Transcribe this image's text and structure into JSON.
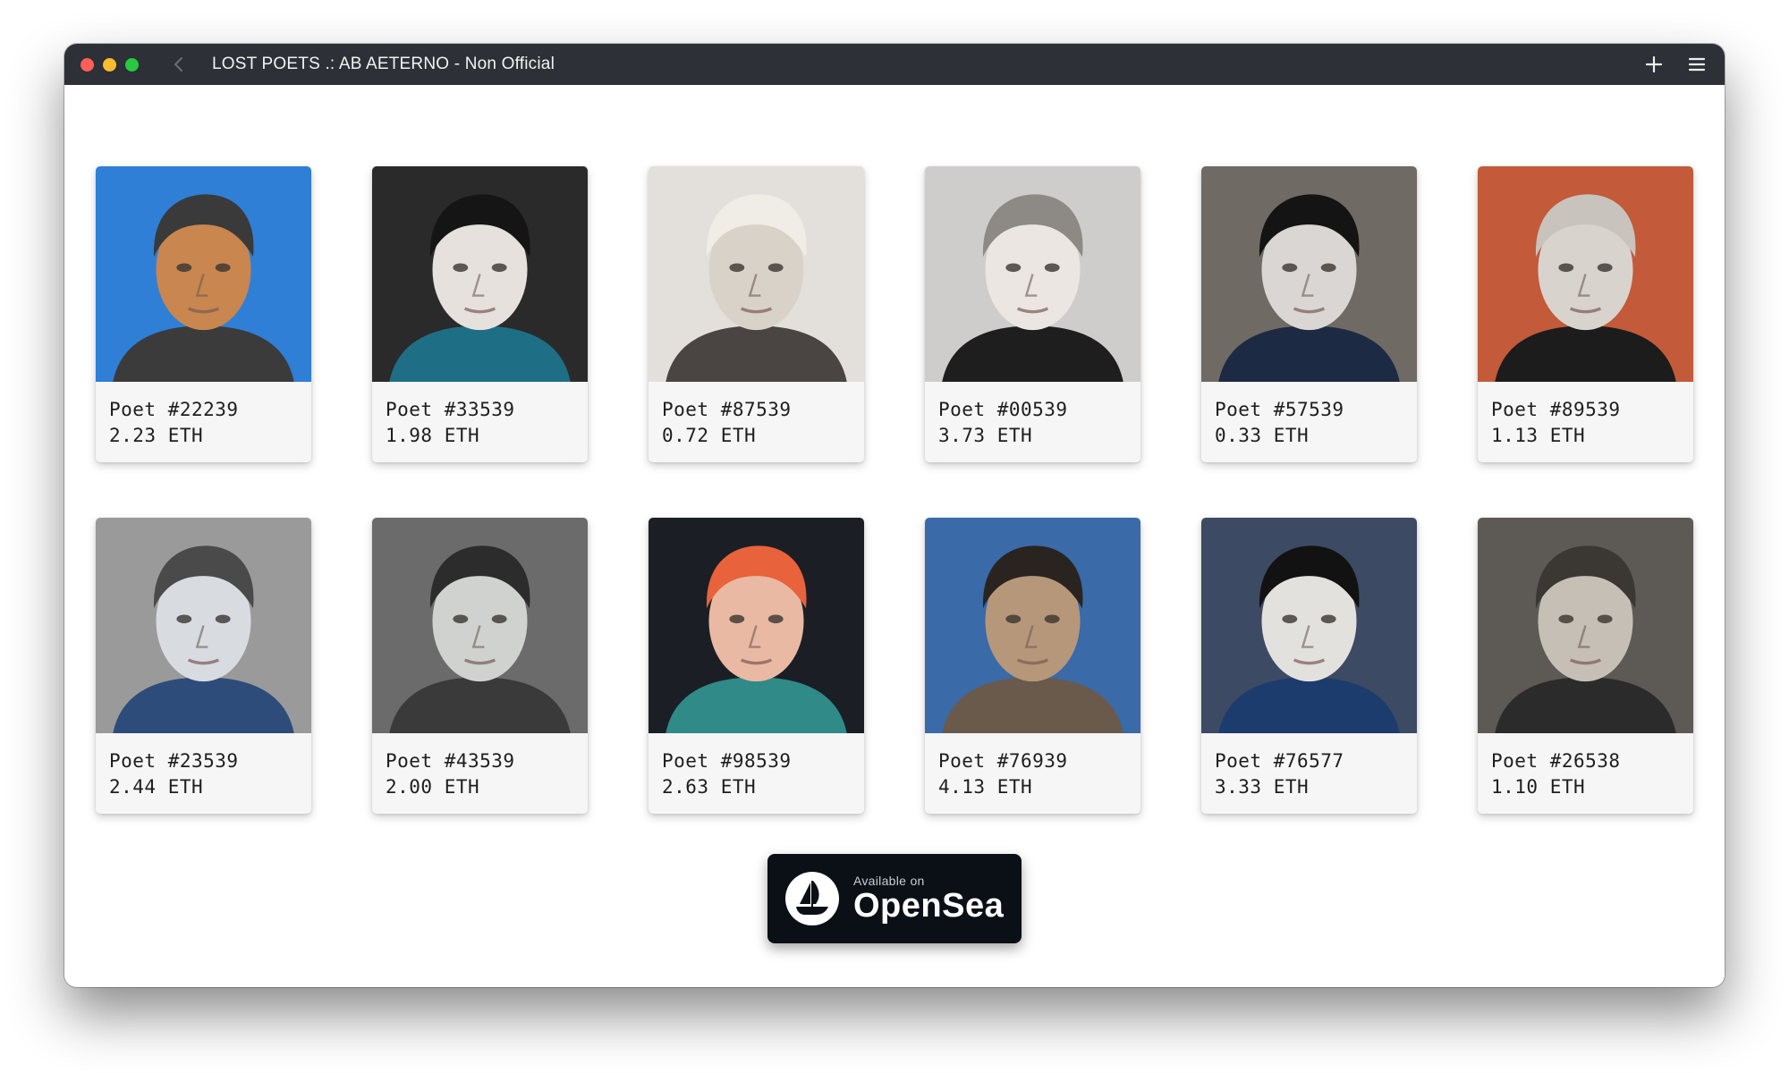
{
  "window": {
    "title": "LOST POETS .: AB AETERNO - Non Official"
  },
  "poets": [
    {
      "name": "Poet #22239",
      "price": "2.23 ETH",
      "bg": "#2f7fd6",
      "skin": "#c9864f",
      "hair": "#3a3a3a",
      "shirt": "#3b3b3b"
    },
    {
      "name": "Poet #33539",
      "price": "1.98 ETH",
      "bg": "#2a2a2a",
      "skin": "#e6e1dc",
      "hair": "#151515",
      "shirt": "#1e6f86"
    },
    {
      "name": "Poet #87539",
      "price": "0.72 ETH",
      "bg": "#e3e0dc",
      "skin": "#d9d2c8",
      "hair": "#f0ece6",
      "shirt": "#4a4542"
    },
    {
      "name": "Poet #00539",
      "price": "3.73 ETH",
      "bg": "#cfcdcb",
      "skin": "#ece6e2",
      "hair": "#8d8a86",
      "shirt": "#1e1e1e"
    },
    {
      "name": "Poet #57539",
      "price": "0.33 ETH",
      "bg": "#6f6a63",
      "skin": "#d9d6d3",
      "hair": "#141414",
      "shirt": "#1d2a44"
    },
    {
      "name": "Poet #89539",
      "price": "1.13 ETH",
      "bg": "#c35a3a",
      "skin": "#d8d3cd",
      "hair": "#c8c3bd",
      "shirt": "#1c1c1c"
    },
    {
      "name": "Poet #23539",
      "price": "2.44 ETH",
      "bg": "#9a9a9a",
      "skin": "#d8dbe0",
      "hair": "#4a4a4a",
      "shirt": "#2d4c7a"
    },
    {
      "name": "Poet #43539",
      "price": "2.00 ETH",
      "bg": "#6b6b6b",
      "skin": "#cfd2cf",
      "hair": "#2c2c2c",
      "shirt": "#3a3a3a"
    },
    {
      "name": "Poet #98539",
      "price": "2.63 ETH",
      "bg": "#1b1f25",
      "skin": "#e9b9a4",
      "hair": "#e8623b",
      "shirt": "#2f8a88"
    },
    {
      "name": "Poet #76939",
      "price": "4.13 ETH",
      "bg": "#3a6aa8",
      "skin": "#b7977a",
      "hair": "#2a2420",
      "shirt": "#6a5a4c"
    },
    {
      "name": "Poet #76577",
      "price": "3.33 ETH",
      "bg": "#3d4a63",
      "skin": "#e3e1de",
      "hair": "#121212",
      "shirt": "#1d3c6e"
    },
    {
      "name": "Poet #26538",
      "price": "1.10 ETH",
      "bg": "#5d5a55",
      "skin": "#c6bfb5",
      "hair": "#3b3834",
      "shirt": "#2b2b2b"
    }
  ],
  "opensea": {
    "small_label": "Available on",
    "big_label": "OpenSea"
  },
  "icons": {
    "back": "chevron-left-icon",
    "add": "plus-icon",
    "menu": "hamburger-menu-icon",
    "opensea": "opensea-ship-icon"
  }
}
